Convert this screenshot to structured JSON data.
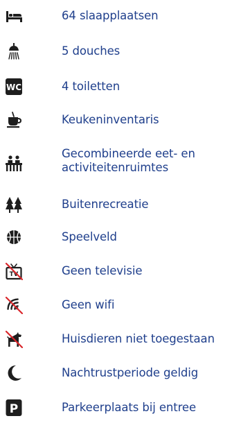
{
  "facilities": [
    {
      "icon": "bed-icon",
      "label": "64 slaapplaatsen"
    },
    {
      "icon": "shower-icon",
      "label": "5 douches"
    },
    {
      "icon": "wc-icon",
      "icon_text": "WC",
      "label": "4 toiletten"
    },
    {
      "icon": "coffee-cup-icon",
      "label": "Keukeninventaris"
    },
    {
      "icon": "dining-table-icon",
      "label_line1": "Gecombineerde eet- en",
      "label_line2": "activiteitenruimtes"
    },
    {
      "icon": "trees-icon",
      "label": "Buitenrecreatie"
    },
    {
      "icon": "basketball-icon",
      "label": "Speelveld"
    },
    {
      "icon": "no-television-icon",
      "icon_text": "TV",
      "label": "Geen televisie"
    },
    {
      "icon": "no-wifi-icon",
      "label": "Geen wifi"
    },
    {
      "icon": "no-pets-icon",
      "label": "Huisdieren niet toegestaan"
    },
    {
      "icon": "moon-icon",
      "label": "Nachtrustperiode geldig"
    },
    {
      "icon": "parking-icon",
      "icon_text": "P",
      "label": "Parkeerplaats bij entree"
    }
  ],
  "colors": {
    "icon": "#1e1e1e",
    "text": "#1f3f8c",
    "prohibited": "#d9262b"
  }
}
